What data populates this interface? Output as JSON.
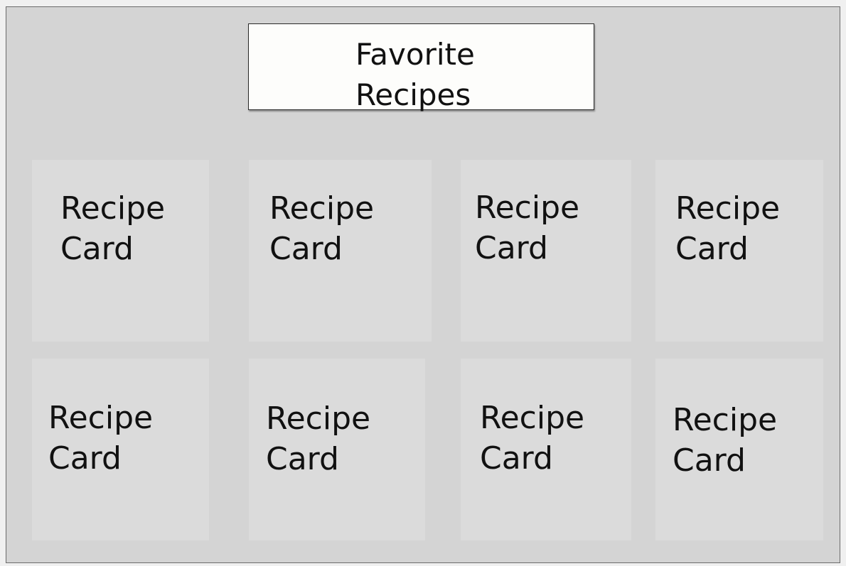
{
  "header": {
    "title": "Favorite\nRecipes"
  },
  "cards": [
    {
      "label": "Recipe\nCard"
    },
    {
      "label": "Recipe\nCard"
    },
    {
      "label": "Recipe\nCard"
    },
    {
      "label": "Recipe\nCard"
    },
    {
      "label": "Recipe\nCard"
    },
    {
      "label": "Recipe\nCard"
    },
    {
      "label": "Recipe\nCard"
    },
    {
      "label": "Recipe\nCard"
    }
  ],
  "colors": {
    "frame_background": "#d4d4d4",
    "card_background": "#dbdbdb",
    "title_background": "#fdfdfb"
  }
}
